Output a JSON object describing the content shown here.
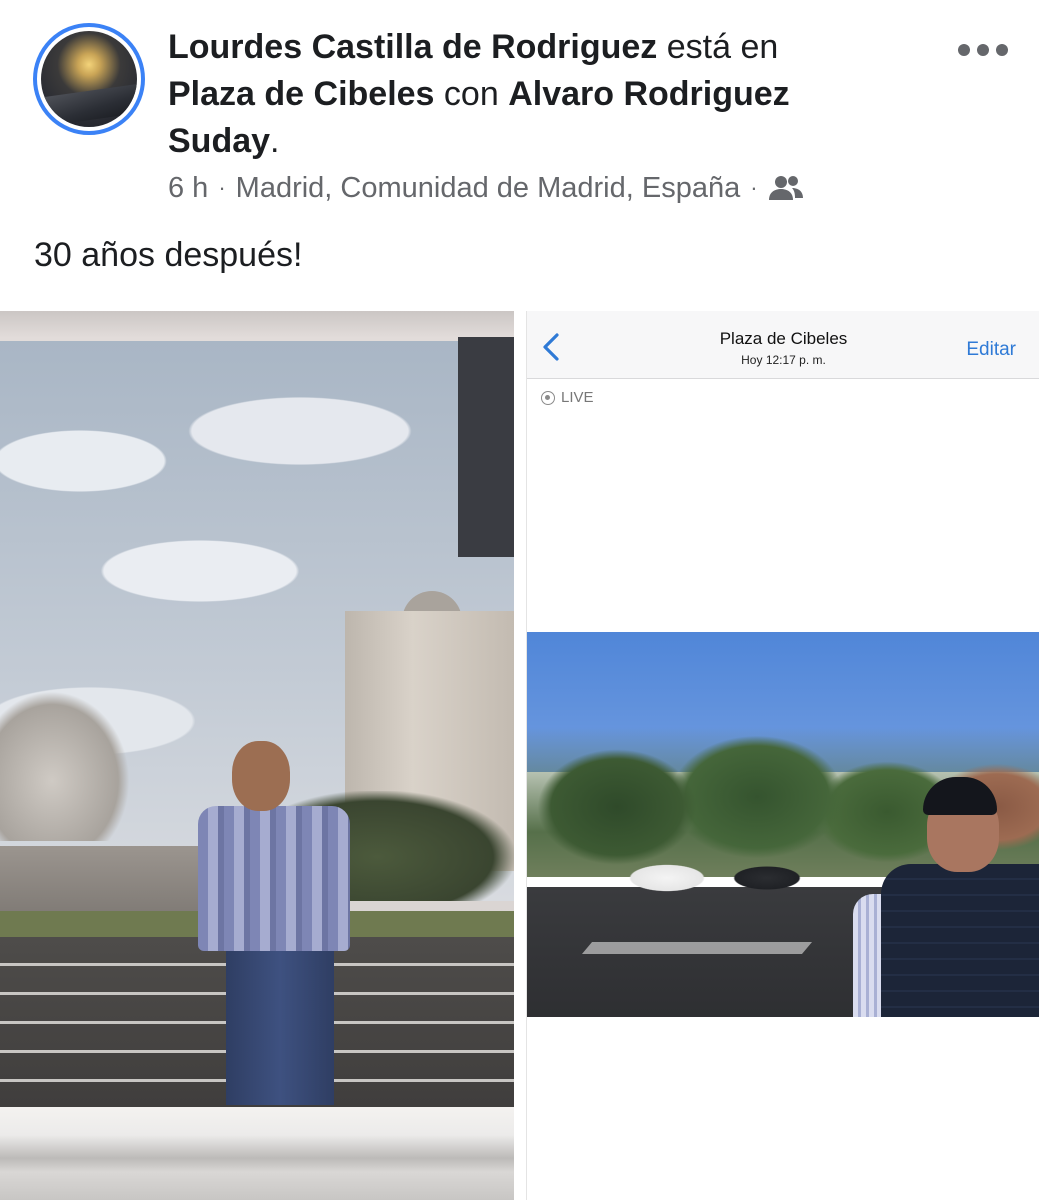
{
  "post": {
    "author": "Lourdes Castilla de Rodriguez",
    "connector_is_at": "está en",
    "place": "Plaza de Cibeles",
    "connector_with": "con",
    "tagged_person_line1": "Alvaro Rodriguez",
    "tagged_person_line2": "Suday",
    "period": ".",
    "time_ago": "6 h",
    "location": "Madrid, Comunidad de Madrid, España",
    "separator": "·",
    "privacy_icon": "friends-icon",
    "caption": "30 años después!",
    "more_icon": "more-options-icon",
    "accent_color": "#3b82f6"
  },
  "phone_screenshot": {
    "title": "Plaza de Cibeles",
    "subtitle": "Hoy 12:17 p. m.",
    "edit_label": "Editar",
    "live_label": "LIVE",
    "back_icon": "chevron-left-icon",
    "link_color": "#2f7ad6"
  }
}
